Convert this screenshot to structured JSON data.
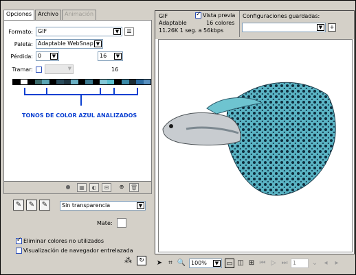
{
  "tabs": [
    {
      "label": "Opciones",
      "state": "active"
    },
    {
      "label": "Archivo",
      "state": "normal"
    },
    {
      "label": "Animación",
      "state": "disabled"
    }
  ],
  "options": {
    "format_label": "Formato:",
    "format_value": "GIF",
    "palette_label": "Paleta:",
    "palette_value": "Adaptable WebSnap",
    "loss_label": "Pérdida:",
    "loss_value": "0",
    "colors_value": "16",
    "colors_count": "16",
    "dither_label": "Tramar:"
  },
  "swatch_colors": [
    "#000000",
    "#ffffff",
    "#000000",
    "#3a6a6a",
    "#5aa6b4",
    "#000000",
    "#2a4c5c",
    "#1e3440",
    "#6ab0c4",
    "#000000",
    "#3c7a90",
    "#000000",
    "#84c8d8",
    "#5ac0d0",
    "#000000",
    "#3a8aa8",
    "#1c2c34",
    "#2a6aa0",
    "#5890c0"
  ],
  "annotation": {
    "text": "TONOS DE COLOR AZUL ANALIZADOS",
    "color": "#0a3fd1"
  },
  "transparency": {
    "value": "Sin transparencia",
    "matte_label": "Mate:"
  },
  "checkboxes": [
    {
      "label": "Eliminar colores no utilizados",
      "checked": true
    },
    {
      "label": "Visualización de navegador entrelazada",
      "checked": false
    }
  ],
  "preview_header": {
    "format": "GIF",
    "preview_label": "Vista previa",
    "preview_checked": true,
    "palette": "Adaptable",
    "colors": "16 colores",
    "size_info": "11.26K  1 seg. a 56kbps",
    "saved_settings_label": "Configuraciones guardadas:",
    "saved_settings_value": ""
  },
  "zoom": "100%",
  "frame_number": "1",
  "icons": {
    "pointer": "pointer-icon",
    "crop": "crop-icon",
    "zoom": "zoom-icon",
    "play": "play-icon"
  },
  "colors": {
    "panel": "#d4d0c8",
    "accent_blue": "#0a3fd1",
    "fish_teal": "#5ab4c4"
  }
}
